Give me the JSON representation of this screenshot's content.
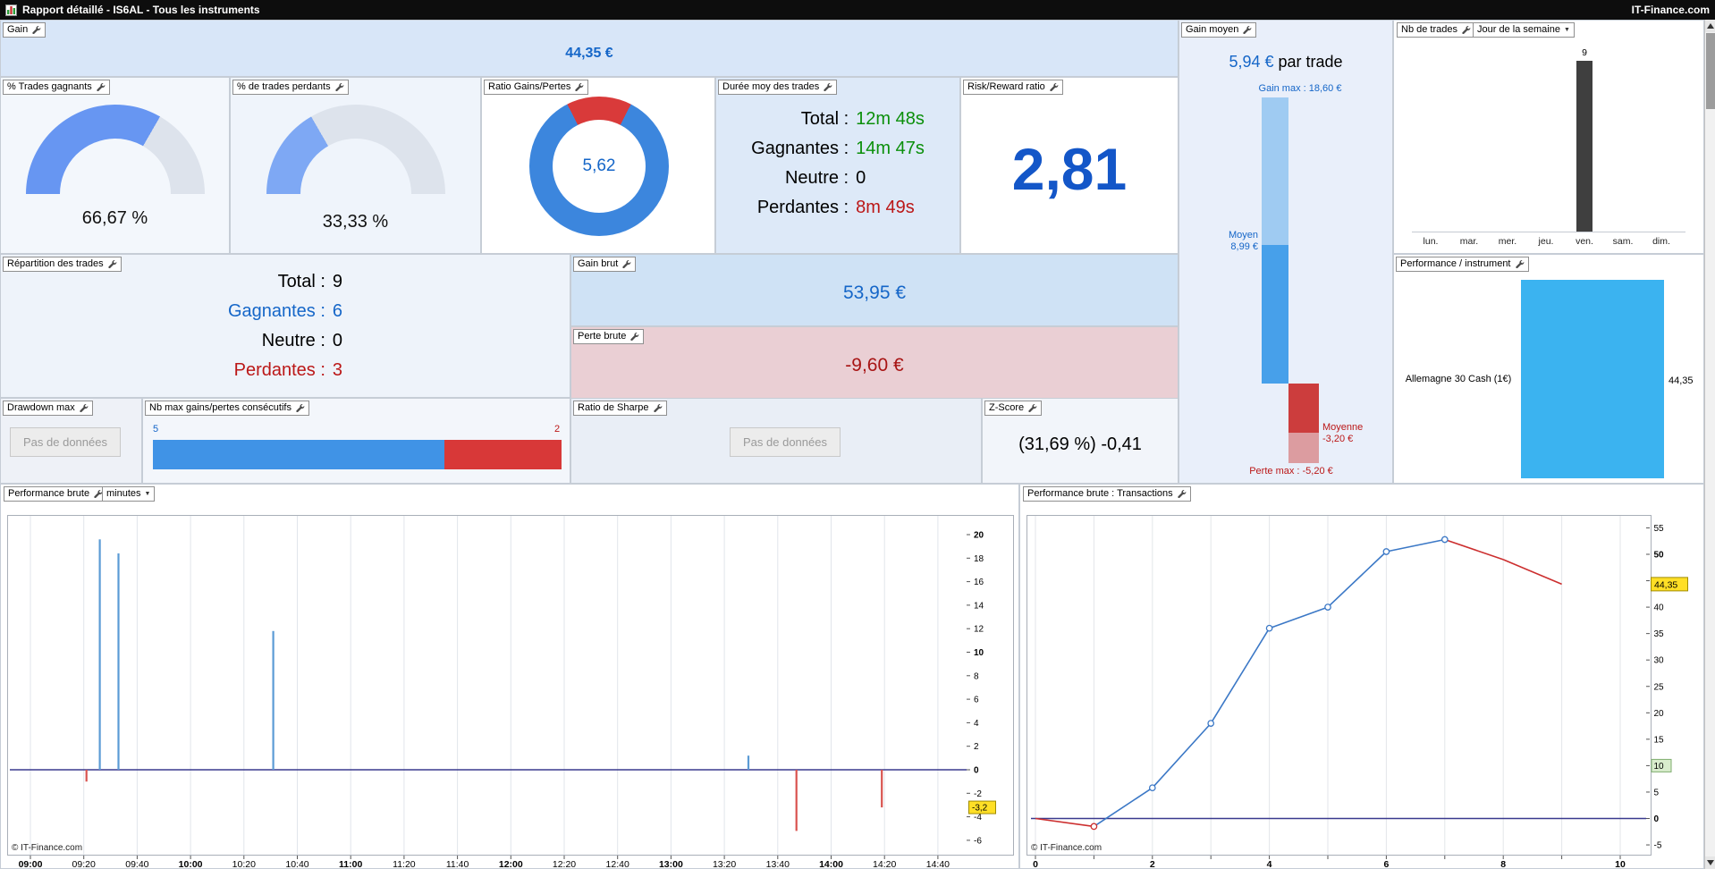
{
  "titlebar": {
    "title": "Rapport détaillé - IS6AL - Tous les instruments",
    "brand": "IT-Finance.com"
  },
  "colors": {
    "accent_blue": "#1566c8",
    "gain_green": "#0a8f0a",
    "loss_red": "#bb1717",
    "gain_bg": "#d8e6f8",
    "loss_bg": "#eacfd4"
  },
  "panels": {
    "gain": {
      "label": "Gain",
      "value": "44,35 €"
    },
    "pct_gagnants": {
      "label": "% Trades gagnants",
      "value": "66,67 %"
    },
    "pct_perdants": {
      "label": "% de trades perdants",
      "value": "33,33 %"
    },
    "ratio_gains_pertes": {
      "label": "Ratio Gains/Pertes",
      "value": "5,62"
    },
    "duree": {
      "label": "Durée moy des trades",
      "rows": [
        {
          "label": "Total :",
          "value": "12m 48s"
        },
        {
          "label": "Gagnantes :",
          "value": "14m 47s"
        },
        {
          "label": "Neutre :",
          "value": "0"
        },
        {
          "label": "Perdantes :",
          "value": "8m 49s"
        }
      ]
    },
    "risk_reward": {
      "label": "Risk/Reward ratio",
      "value": "2,81"
    },
    "repartition": {
      "label": "Répartition des trades",
      "rows": [
        {
          "label": "Total :",
          "value": "9"
        },
        {
          "label": "Gagnantes :",
          "value": "6"
        },
        {
          "label": "Neutre :",
          "value": "0"
        },
        {
          "label": "Perdantes :",
          "value": "3"
        }
      ]
    },
    "gain_brut": {
      "label": "Gain brut",
      "value": "53,95 €"
    },
    "perte_brute": {
      "label": "Perte brute",
      "value": "-9,60 €"
    },
    "drawdown": {
      "label": "Drawdown max",
      "no_data": "Pas de données"
    },
    "consecutifs": {
      "label": "Nb max gains/pertes consécutifs",
      "gains": "5",
      "pertes": "2"
    },
    "sharpe": {
      "label": "Ratio de Sharpe",
      "no_data": "Pas de données"
    },
    "zscore": {
      "label": "Z-Score",
      "value": "(31,69 %) -0,41"
    },
    "gain_moyen": {
      "label": "Gain moyen",
      "value": "5,94 €",
      "suffix": " par trade",
      "gain_max_label": "Gain max : 18,60 €",
      "moyen_label_1": "Moyen",
      "moyen_label_2": "8,99 €",
      "moyenne_label_1": "Moyenne",
      "moyenne_label_2": "-3,20 €",
      "perte_max_label": "Perte max : -5,20 €"
    },
    "nb_trades": {
      "label": "Nb de trades",
      "dropdown": "Jour de la semaine"
    },
    "perf_instrument": {
      "label": "Performance / instrument",
      "instrument": "Allemagne 30 Cash (1€)",
      "value": "44,35"
    },
    "perf_brute": {
      "label": "Performance brute",
      "dropdown": "minutes",
      "copyright": "© IT-Finance.com"
    },
    "perf_transactions": {
      "label": "Performance brute : Transactions",
      "copyright": "© IT-Finance.com"
    }
  },
  "chart_data": [
    {
      "id": "win_gauge",
      "type": "pie",
      "title": "% Trades gagnants",
      "value_pct": 66.67,
      "color": "#6796f2",
      "track": "#dde3ec"
    },
    {
      "id": "lose_gauge",
      "type": "pie",
      "title": "% de trades perdants",
      "value_pct": 33.33,
      "color": "#7ea8f4",
      "track": "#dde3ec"
    },
    {
      "id": "ratio_donut",
      "type": "pie",
      "title": "Ratio Gains/Pertes",
      "value": 5.62,
      "loss_pct": 15.1,
      "win_color": "#3c86dd",
      "loss_color": "#d93a3a"
    },
    {
      "id": "gain_moyen",
      "type": "bar",
      "title": "Gain moyen (€)",
      "values": {
        "gain_max": 18.6,
        "moyen": 8.99,
        "moyenne": -3.2,
        "perte_max": -5.2
      },
      "colors": {
        "gain_max": "#9fcbf2",
        "moyen": "#47a0ea",
        "moyenne": "#cc3d3d",
        "perte_max": "#dc9ca0"
      }
    },
    {
      "id": "trades_weekday",
      "type": "bar",
      "title": "Nb de trades / Jour de la semaine",
      "categories": [
        "lun.",
        "mar.",
        "mer.",
        "jeu.",
        "ven.",
        "sam.",
        "dim."
      ],
      "values": [
        0,
        0,
        0,
        0,
        9,
        0,
        0
      ],
      "bar_color": "#3f3f3f",
      "ylim": [
        0,
        9
      ]
    },
    {
      "id": "perf_instrument",
      "type": "bar",
      "title": "Performance / instrument",
      "categories": [
        "Allemagne 30 Cash (1€)"
      ],
      "values": [
        44.35
      ],
      "bar_color": "#3bb3f0"
    },
    {
      "id": "perf_minutes",
      "type": "bar",
      "title": "Performance brute (minutes)",
      "bars": [
        {
          "t": "09:21",
          "v": -1.0
        },
        {
          "t": "09:26",
          "v": 19.6
        },
        {
          "t": "09:33",
          "v": 18.4
        },
        {
          "t": "10:31",
          "v": 11.8
        },
        {
          "t": "13:29",
          "v": 1.2
        },
        {
          "t": "13:47",
          "v": -5.2
        },
        {
          "t": "14:19",
          "v": -3.2
        }
      ],
      "xticks": [
        "09:00",
        "09:20",
        "09:40",
        "10:00",
        "10:20",
        "10:40",
        "11:00",
        "11:20",
        "11:40",
        "12:00",
        "12:20",
        "12:40",
        "13:00",
        "13:20",
        "13:40",
        "14:00",
        "14:20",
        "14:40"
      ],
      "ylim": [
        -6,
        20
      ],
      "ytick_step": 2,
      "bold_yticks": [
        20,
        10,
        0
      ],
      "pos_color": "#5b9bd5",
      "neg_color": "#d9534f",
      "zero_color": "#3a3a8e",
      "tag": {
        "value": -3.2,
        "label": "-3,2"
      }
    },
    {
      "id": "perf_transactions",
      "type": "line",
      "title": "Performance brute : Transactions",
      "x": [
        0,
        1,
        2,
        3,
        4,
        5,
        6,
        7,
        8,
        9
      ],
      "values": [
        0,
        -1.5,
        5.8,
        18,
        36,
        40,
        50.5,
        52.8,
        49,
        44.35
      ],
      "red_segments": [
        0,
        7,
        8
      ],
      "red_markers": [
        1
      ],
      "markers": [
        1,
        2,
        3,
        4,
        5,
        6,
        7
      ],
      "xticks": [
        0,
        2,
        4,
        6,
        8,
        10
      ],
      "xlim": [
        0,
        10
      ],
      "ylim": [
        -5,
        55
      ],
      "ytick_step": 5,
      "bold_yticks": [
        50,
        0
      ],
      "up_color": "#3b78c6",
      "down_color": "#cc2e2e",
      "zero_color": "#3a3a8e",
      "tag": {
        "value": 44.35,
        "label": "44,35"
      },
      "green_tag": {
        "value": 10,
        "label": "10"
      }
    }
  ]
}
